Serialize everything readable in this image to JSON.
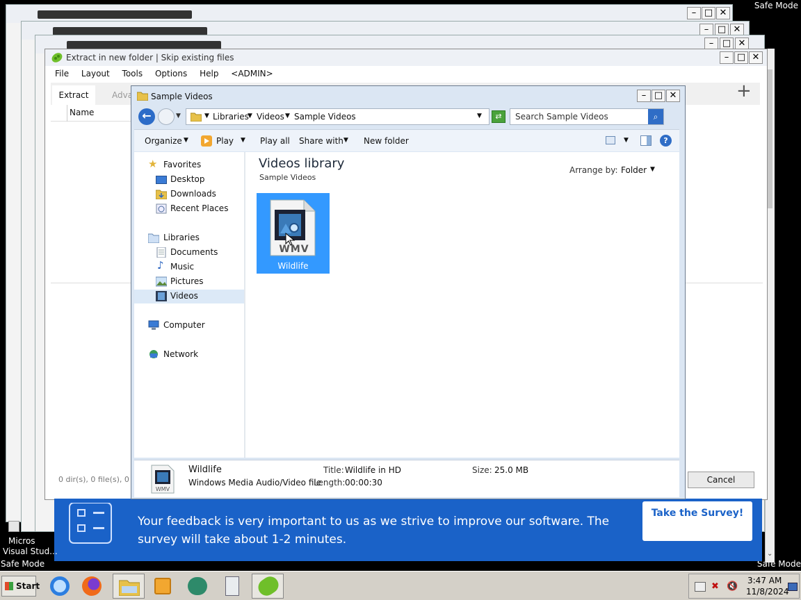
{
  "safe_mode": "Safe Mode",
  "outer_window": {
    "title": "Extract in new folder | Skip existing files",
    "menu": [
      "File",
      "Layout",
      "Tools",
      "Options",
      "Help",
      "<ADMIN>"
    ],
    "tabs": {
      "extract": "Extract",
      "advanced": "Adva"
    },
    "column_name": "Name",
    "status": "0 dir(s), 0 file(s), 0 B",
    "cancel": "Cancel",
    "plus": "+"
  },
  "dialog": {
    "title": "Sample Videos",
    "breadcrumb": [
      "Libraries",
      "Videos",
      "Sample Videos"
    ],
    "search_placeholder": "Search Sample Videos",
    "toolbar": {
      "organize": "Organize",
      "play": "Play",
      "play_all": "Play all",
      "share_with": "Share with",
      "new_folder": "New folder"
    },
    "nav": {
      "favorites": "Favorites",
      "desktop": "Desktop",
      "downloads": "Downloads",
      "recent_places": "Recent Places",
      "libraries": "Libraries",
      "documents": "Documents",
      "music": "Music",
      "pictures": "Pictures",
      "videos": "Videos",
      "computer": "Computer",
      "network": "Network"
    },
    "library_title": "Videos library",
    "library_sub": "Sample Videos",
    "arrange_by_label": "Arrange by:",
    "arrange_by_value": "Folder",
    "file": {
      "name": "Wildlife",
      "badge": "WMV"
    },
    "details": {
      "name": "Wildlife",
      "type": "Windows Media Audio/Video file",
      "title_label": "Title:",
      "title_value": "Wildlife in HD",
      "length_label": "Length:",
      "length_value": "00:00:30",
      "size_label": "Size:",
      "size_value": "25.0 MB"
    }
  },
  "banner": {
    "text_line1": "Your feedback is very important to us as we strive to improve our software. The",
    "text_line2": "survey will take about 1-2 minutes.",
    "button": "Take the Survey!"
  },
  "desktop_icon": {
    "line1": "Micros",
    "line2": "Visual Stud..."
  },
  "taskbar": {
    "start": "Start",
    "time": "3:47 AM",
    "date": "11/8/2024"
  },
  "colors": {
    "accent_blue": "#1a62c8",
    "selection": "#3399ff",
    "banner": "#1a62c8"
  }
}
